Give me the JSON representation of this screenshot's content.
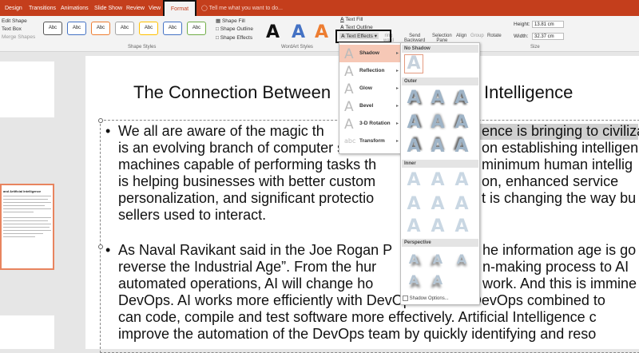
{
  "ribbon_tabs": {
    "design": "Design",
    "transitions": "Transitions",
    "animations": "Animations",
    "slideshow": "Slide Show",
    "review": "Review",
    "view": "View",
    "format": "Format",
    "tellme": "Tell me what you want to do..."
  },
  "ribbon": {
    "edit_shape": "Edit Shape",
    "text_box": "Text Box",
    "merge_shapes": "Merge Shapes",
    "swatch_label": "Abc",
    "shape_fill": "Shape Fill",
    "shape_outline": "Shape Outline",
    "shape_effects": "Shape Effects",
    "wordart_letter": "A",
    "text_fill": "Text Fill",
    "text_outline": "Text Outline",
    "text_effects": "Text Effects",
    "send_backward_1": "Send",
    "send_backward_2": "Backward",
    "selection_pane_1": "Selection",
    "selection_pane_2": "Pane",
    "bring_forward": "ring",
    "bring_forward_2": "ward",
    "align": "Align",
    "group": "Group",
    "rotate": "Rotate",
    "height_label": "Height:",
    "height_value": "13.81 cm",
    "width_label": "Width:",
    "width_value": "32.37 cm",
    "group_shape_styles": "Shape Styles",
    "group_wordart_styles": "WordArt Styles",
    "group_size": "Size"
  },
  "colors": {
    "accent": "#c43e1c",
    "swatch_borders": [
      "#555555",
      "#4472c4",
      "#ed7d31",
      "#a5a5a5",
      "#ffc000",
      "#4472c4",
      "#70ad47"
    ],
    "wordart": [
      "#111111",
      "#4472c4",
      "#ed7d31"
    ]
  },
  "thumb": {
    "title": "and Artificial Intelligence"
  },
  "slide": {
    "title_left": "The Connection Between",
    "title_right": "icial Intelligence",
    "para1": [
      "We all are aware of the magic th",
      "is an evolving branch of computer scienc",
      "machines capable of performing tasks th",
      "is helping businesses with better custom",
      "personalization, and significant protectio",
      "sellers used to interact."
    ],
    "para1_right": [
      "ence is bringing to civiliza",
      "on establishing intelligen",
      "minimum human intellig",
      "on, enhanced service",
      "t is changing the way bu",
      ""
    ],
    "para2": [
      "As Naval Ravikant said in the Joe Rogan P",
      "reverse the Industrial Age”. From the hur",
      "automated operations, AI will change ho",
      "DevOps. AI works more efficiently with DevOps. AI and DevOps combined to",
      "can code, compile and test software more effectively. Artificial Intelligence c",
      "improve the automation of the DevOps team by quickly identifying and reso"
    ],
    "para2_right": [
      "he information age is go",
      "n-making process to AI",
      "work. And this is immine",
      "",
      "",
      ""
    ]
  },
  "text_effects_menu": {
    "items": [
      "Shadow",
      "Reflection",
      "Glow",
      "Bevel",
      "3-D Rotation",
      "Transform"
    ],
    "icon_letter": "A",
    "transform_icon": "abc"
  },
  "shadow_gallery": {
    "no_shadow": "No Shadow",
    "outer": "Outer",
    "inner": "Inner",
    "perspective": "Perspective",
    "options": "Shadow Options...",
    "letter": "A"
  }
}
